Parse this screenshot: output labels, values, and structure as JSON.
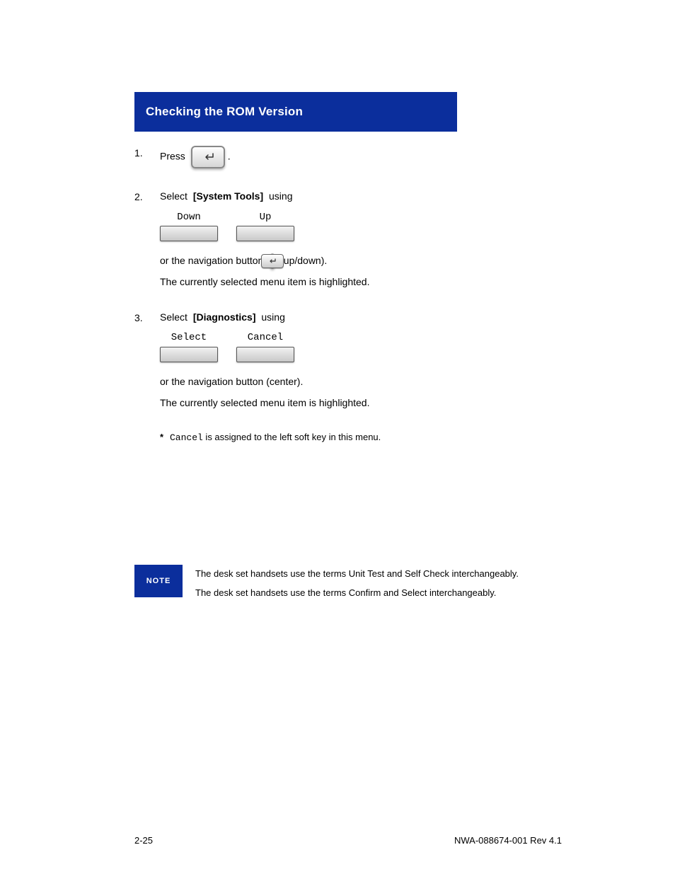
{
  "banner": {
    "title": "Checking the ROM Version"
  },
  "step1": {
    "num": "1.",
    "line1_part1": "Press",
    "line1_part2": "."
  },
  "step2": {
    "num": "2.",
    "line1_part1": "Select",
    "line1_part2": "using",
    "line1_part3": "or the navigation button",
    "line1_part4": "(up/down)",
    "line1_part5": ".",
    "menu_item": "[System Tools]",
    "key_down": "Down",
    "key_up": "Up",
    "line2": "The currently selected menu item is highlighted."
  },
  "step3": {
    "num": "3.",
    "line1_part1": "Select",
    "line1_part2": "using",
    "line1_part3": "or the navigation button (center)",
    "line1_part4": ".",
    "menu_item": "[Diagnostics]",
    "key_select": "Select",
    "key_cancel": "Cancel",
    "line2": "The currently selected menu item is highlighted."
  },
  "star_note": {
    "star": "*",
    "text": " is assigned to the left soft key in this menu."
  },
  "note": {
    "badge": "NOTE",
    "line1": "The desk set handsets use the terms Unit Test and Self Check interchangeably.",
    "line2": "The desk set handsets use the terms Confirm and Select interchangeably."
  },
  "navpad_enter_arrow_label": "↵",
  "footer_left": "2-25",
  "footer_right": "NWA-088674-001 Rev 4.1"
}
